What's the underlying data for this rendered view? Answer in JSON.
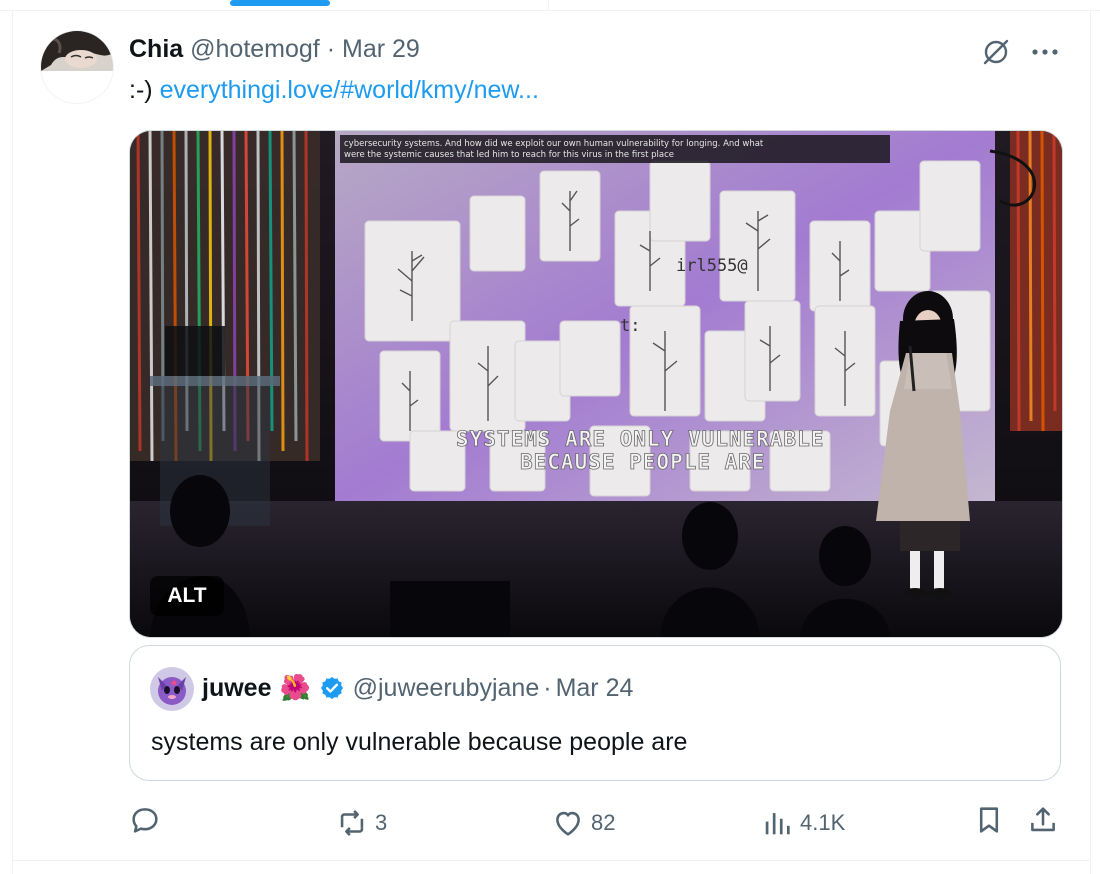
{
  "tweet": {
    "display_name": "Chia",
    "handle": "@hotemogf",
    "separator": "·",
    "date": "Mar 29",
    "text_prefix": ":-)",
    "link_text": "everythingi.love/#world/kmy/new..."
  },
  "media": {
    "alt_label": "ALT",
    "caption_top_line1": "cybersecurity systems. And how did we exploit our own human vulnerability for longing. And what",
    "caption_top_line2": "were the systemic causes that led him to reach for this virus in the first place",
    "screen_text_line1": "SYSTEMS ARE ONLY VULNERABLE",
    "screen_text_line2": "BECAUSE PEOPLE ARE",
    "screen_fragment_1": "irl555@",
    "screen_fragment_2": "t:"
  },
  "quote": {
    "display_name": "juwee",
    "emoji": "🌺",
    "handle": "@juweerubyjane",
    "separator": "·",
    "date": "Mar 24",
    "text": "systems are only vulnerable because people are"
  },
  "actions": {
    "reply_count": "",
    "retweet_count": "3",
    "like_count": "82",
    "views_count": "4.1K"
  },
  "icons": {
    "grok": "grok-slash-circle-icon",
    "more": "more-dots-icon",
    "reply": "reply-bubble-icon",
    "retweet": "retweet-icon",
    "like": "heart-icon",
    "views": "views-bars-icon",
    "bookmark": "bookmark-icon",
    "share": "share-upload-icon",
    "verified": "verified-badge-icon"
  },
  "colors": {
    "accent": "#1d9bf0",
    "muted": "#536471",
    "text": "#0f1419",
    "border": "#cfd9de"
  }
}
